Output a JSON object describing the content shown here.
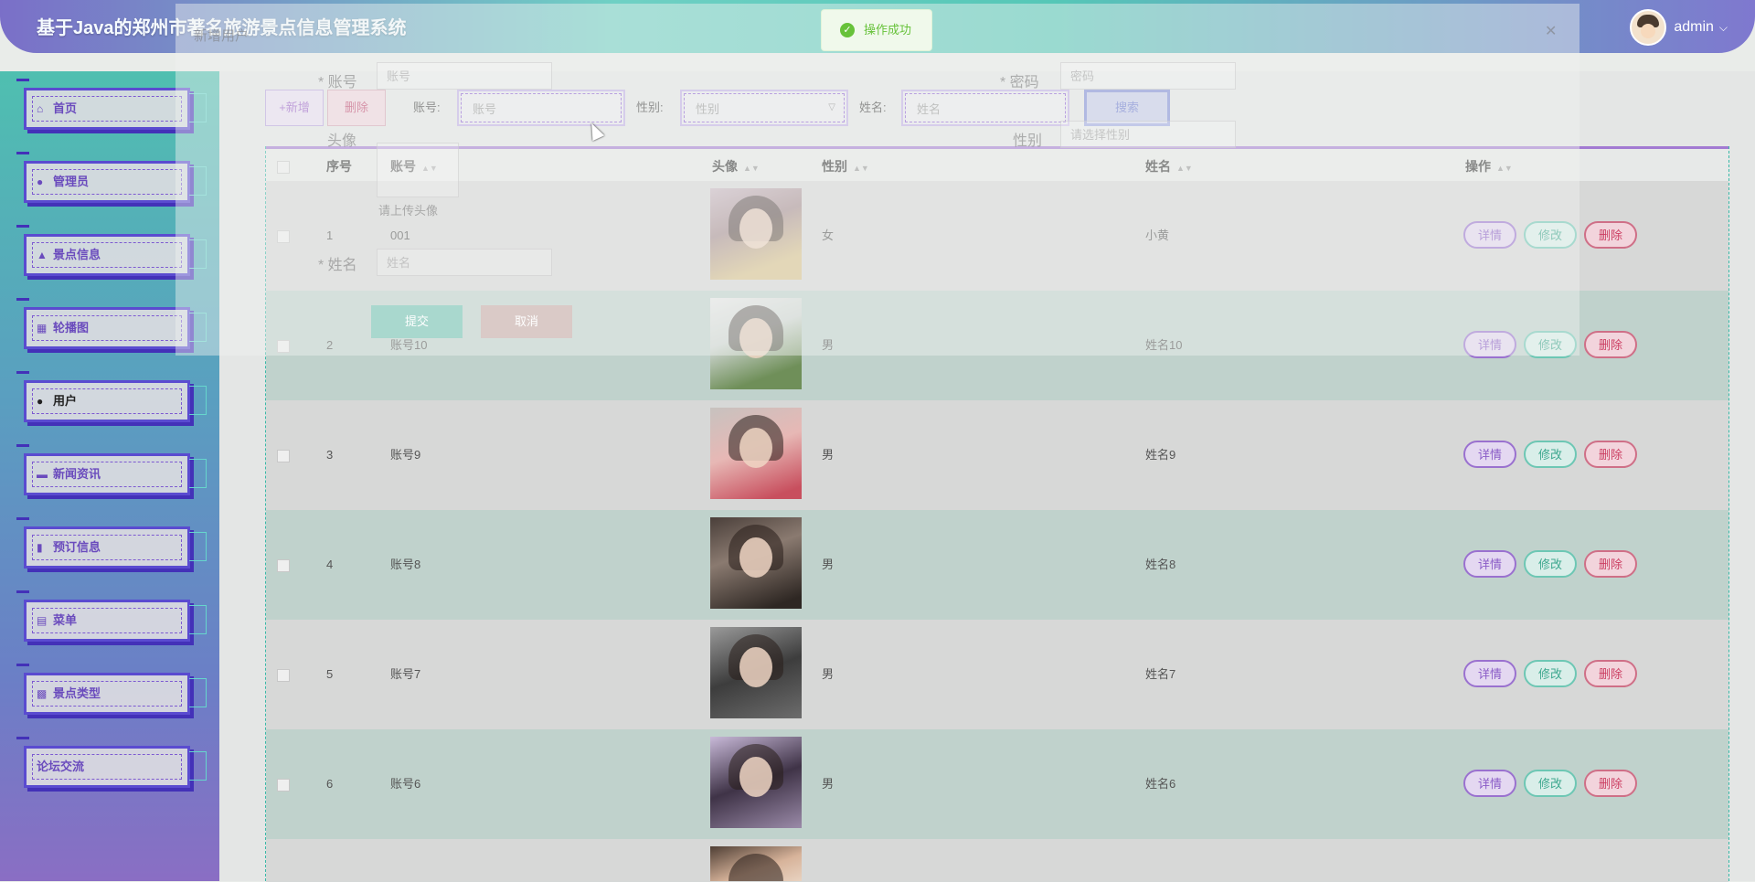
{
  "header": {
    "title": "基于Java的郑州市著名旅游景点信息管理系统",
    "user": "admin"
  },
  "toast": {
    "text": "操作成功"
  },
  "sidebar": {
    "items": [
      {
        "label": "首页",
        "icon": "home-icon"
      },
      {
        "label": "管理员",
        "icon": "user-icon"
      },
      {
        "label": "景点信息",
        "icon": "scenic-icon"
      },
      {
        "label": "轮播图",
        "icon": "image-icon"
      },
      {
        "label": "用户",
        "icon": "user-icon",
        "active": true
      },
      {
        "label": "新闻资讯",
        "icon": "news-icon"
      },
      {
        "label": "预订信息",
        "icon": "booking-icon"
      },
      {
        "label": "菜单",
        "icon": "menu-icon"
      },
      {
        "label": "景点类型",
        "icon": "grid-icon"
      },
      {
        "label": "论坛交流",
        "icon": ""
      }
    ]
  },
  "toolbar": {
    "add_label": "+新增",
    "delete_label": "删除",
    "account_label": "账号:",
    "account_placeholder": "账号",
    "gender_label": "性别:",
    "gender_placeholder": "性别",
    "name_label": "姓名:",
    "name_placeholder": "姓名",
    "search_label": "搜索"
  },
  "table": {
    "headers": {
      "index": "序号",
      "account": "账号",
      "avatar": "头像",
      "gender": "性别",
      "name": "姓名",
      "actions": "操作"
    },
    "action_labels": {
      "detail": "详情",
      "edit": "修改",
      "delete": "删除"
    },
    "rows": [
      {
        "index": "1",
        "account": "001",
        "gender": "女",
        "name": "小黄"
      },
      {
        "index": "2",
        "account": "账号10",
        "gender": "男",
        "name": "姓名10"
      },
      {
        "index": "3",
        "account": "账号9",
        "gender": "男",
        "name": "姓名9"
      },
      {
        "index": "4",
        "account": "账号8",
        "gender": "男",
        "name": "姓名8"
      },
      {
        "index": "5",
        "account": "账号7",
        "gender": "男",
        "name": "姓名7"
      },
      {
        "index": "6",
        "account": "账号6",
        "gender": "男",
        "name": "姓名6"
      }
    ]
  },
  "dialog": {
    "title": "新增用户",
    "account_label": "* 账号",
    "account_placeholder": "账号",
    "password_label": "* 密码",
    "password_placeholder": "密码",
    "avatar_label": "头像",
    "upload_hint": "请上传头像",
    "gender_label": "性别",
    "gender_placeholder": "请选择性别",
    "name_label": "* 姓名",
    "name_placeholder": "姓名",
    "submit_label": "提交",
    "cancel_label": "取消"
  },
  "colors": {
    "accent_purple": "#8a5cc7",
    "accent_teal": "#3ea88f",
    "danger": "#cc3e62",
    "success": "#67c23a"
  }
}
